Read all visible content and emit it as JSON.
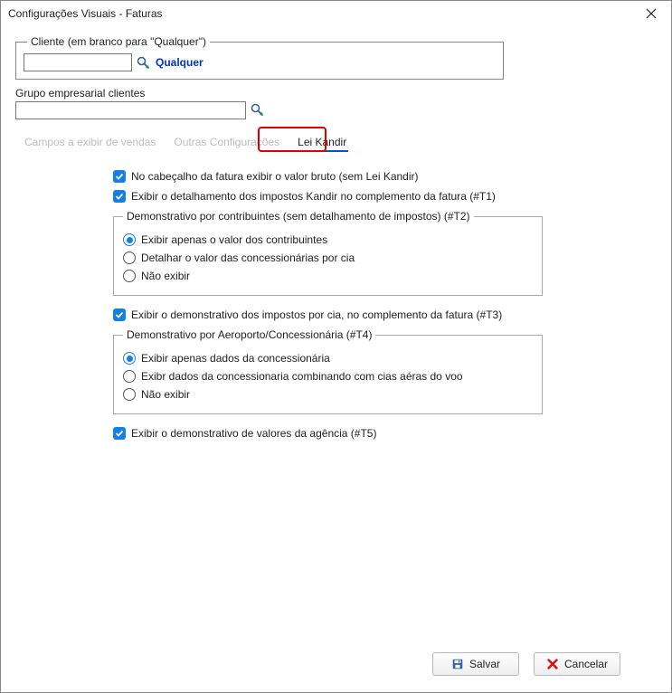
{
  "window": {
    "title": "Configurações Visuais - Faturas"
  },
  "cliente": {
    "legend": "Cliente (em branco para \"Qualquer\")",
    "value": "",
    "qualquer_label": "Qualquer"
  },
  "grupo": {
    "label": "Grupo empresarial clientes",
    "value": ""
  },
  "tabs": {
    "items": [
      {
        "label": "Campos a exibir de vendas"
      },
      {
        "label": "Outras Configurações"
      },
      {
        "label": "Lei Kandir"
      }
    ],
    "active_index": 2
  },
  "leikandir": {
    "chk1": "No cabeçalho da fatura exibir o valor bruto (sem Lei Kandir)",
    "chk2": "Exibir o detalhamento dos impostos Kandir no complemento da fatura (#T1)",
    "group1": {
      "legend": "Demonstrativo por contribuintes (sem detalhamento de impostos) (#T2)",
      "opt1": "Exibir apenas o valor dos contribuintes",
      "opt2": "Detalhar o valor das concessionárias por cia",
      "opt3": "Não exibir"
    },
    "chk3": "Exibir o demonstrativo dos impostos por cia, no complemento da fatura (#T3)",
    "group2": {
      "legend": "Demonstrativo por Aeroporto/Concessionária (#T4)",
      "opt1": "Exibir apenas dados da concessionária",
      "opt2": "Exibr dados da concessionaria combinando com cias aéras do voo",
      "opt3": "Não exibir"
    },
    "chk4": "Exibir o demonstrativo de valores da agência (#T5)"
  },
  "footer": {
    "save": "Salvar",
    "cancel": "Cancelar"
  }
}
